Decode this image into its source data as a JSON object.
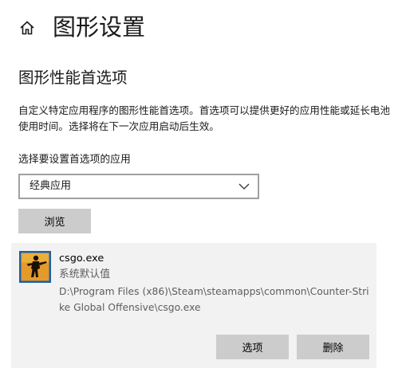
{
  "header": {
    "home_icon": "home-icon",
    "title": "图形设置"
  },
  "section": {
    "title": "图形性能首选项",
    "description": "自定义特定应用程序的图形性能首选项。首选项可以提供更好的应用性能或延长电池使用时间。选择将在下一次应用启动后生效。"
  },
  "app_picker": {
    "label": "选择要设置首选项的应用",
    "selected": "经典应用",
    "chevron_icon": "chevron-down-icon",
    "browse_label": "浏览"
  },
  "app_card": {
    "icon": "csgo-app-icon",
    "name": "csgo.exe",
    "preference": "系统默认值",
    "path": "D:\\Program Files (x86)\\Steam\\steamapps\\common\\Counter-Strike Global Offensive\\csgo.exe",
    "options_label": "选项",
    "remove_label": "删除"
  },
  "colors": {
    "button_bg": "#cccccc",
    "card_bg": "#f2f2f2",
    "secondary_text": "#5d5d5d"
  }
}
